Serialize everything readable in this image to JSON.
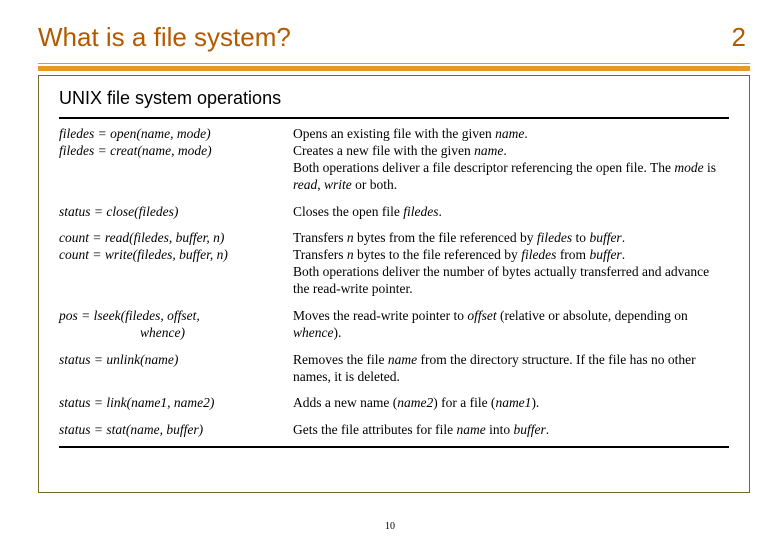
{
  "header": {
    "title": "What is a file system?",
    "page_right": "2"
  },
  "section_heading": "UNIX file system operations",
  "rows": [
    {
      "left_html": "filedes = open(name, mode)<br>filedes = creat(name, mode)",
      "right_html": "Opens an existing file with the given <em>name</em>.<br>Creates a new file with the given <em>name</em>.<br>Both operations deliver a file descriptor referencing the open file. The <em>mode</em> is <em>read</em>, <em>write</em> or both."
    },
    {
      "left_html": "status = close(filedes)",
      "right_html": "Closes the open file <em>filedes</em>."
    },
    {
      "left_html": "count = read(filedes, buffer, n)<br>count = write(filedes, buffer, n)",
      "right_html": "Transfers <em>n</em> bytes from the file referenced by <em>filedes</em> to <em>buffer</em>.<br>Transfers <em>n</em> bytes to the file referenced by <em>filedes</em> from <em>buffer</em>.<br>Both operations deliver the number of bytes actually transferred and advance the read-write pointer."
    },
    {
      "left_html": "pos = lseek(filedes, offset,<br>&nbsp;&nbsp;&nbsp;&nbsp;&nbsp;&nbsp;&nbsp;&nbsp;&nbsp;&nbsp;&nbsp;&nbsp;&nbsp;&nbsp;&nbsp;&nbsp;&nbsp;&nbsp;&nbsp;&nbsp;&nbsp;&nbsp;&nbsp;&nbsp;whence)",
      "right_html": "Moves the read-write pointer to <em>offset</em> (relative or absolute, depending on <em>whence</em>)."
    },
    {
      "left_html": "status = unlink(name)",
      "right_html": "Removes the file <em>name</em> from the directory structure. If the file has no other names, it is deleted."
    },
    {
      "left_html": "status = link(name1, name2)",
      "right_html": "Adds a new name (<em>name2</em>) for a file (<em>name1</em>)."
    },
    {
      "left_html": "status = stat(name, buffer)",
      "right_html": "Gets the file attributes for file <em>name</em> into <em>buffer</em>."
    }
  ],
  "footer_page": "10"
}
